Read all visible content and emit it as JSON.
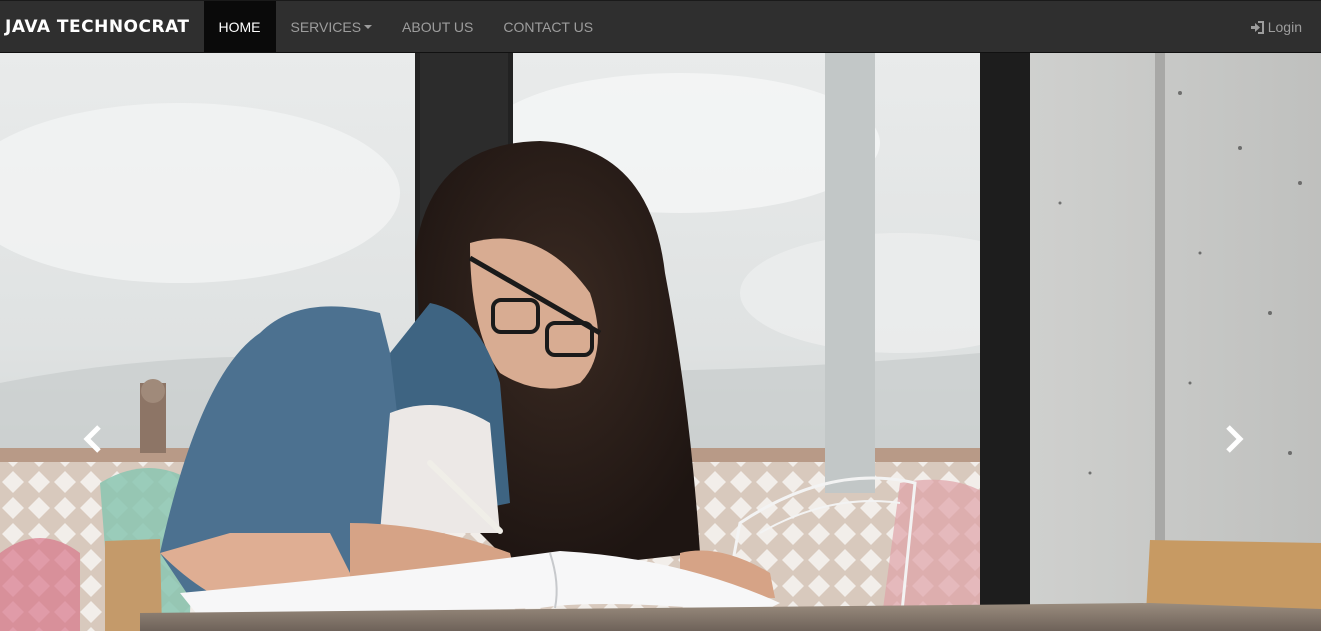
{
  "brand": "JAVA TECHNOCRAT",
  "nav": {
    "home": "HOME",
    "services": "SERVICES",
    "about": "ABOUT US",
    "contact": "CONTACT US"
  },
  "login": "Login",
  "icons": {
    "login": "sign-in-icon",
    "prev": "chevron-left-icon",
    "next": "chevron-right-icon",
    "services": "caret-down-icon"
  },
  "colors": {
    "navbar_bg": "#2f2f2f",
    "active_bg": "#0a0a0a",
    "nav_text": "#9d9d9d",
    "active_text": "#ffffff"
  }
}
